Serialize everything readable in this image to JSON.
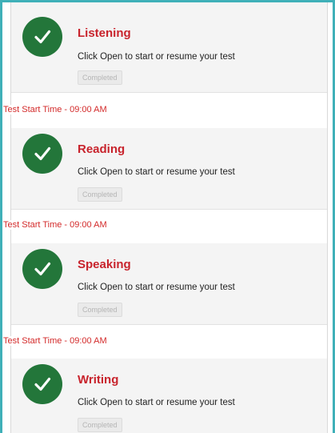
{
  "tests": [
    {
      "title": "Listening",
      "description": "Click Open to start or resume your test",
      "status": "Completed",
      "icon": "check-circle-icon"
    },
    {
      "title": "Reading",
      "description": "Click Open to start or resume your test",
      "status": "Completed",
      "icon": "check-circle-icon"
    },
    {
      "title": "Speaking",
      "description": "Click Open to start or resume your test",
      "status": "Completed",
      "icon": "check-circle-icon"
    },
    {
      "title": "Writing",
      "description": "Click Open to start or resume your test",
      "status": "Completed",
      "icon": "check-circle-icon"
    }
  ],
  "start_times": [
    "Test Start Time - 09:00 AM",
    "Test Start Time - 09:00 AM",
    "Test Start Time - 09:00 AM"
  ],
  "colors": {
    "accent_border": "#3fb0b8",
    "check_green": "#23763a",
    "title_red": "#c8232c",
    "start_time_red": "#d32a2a"
  }
}
